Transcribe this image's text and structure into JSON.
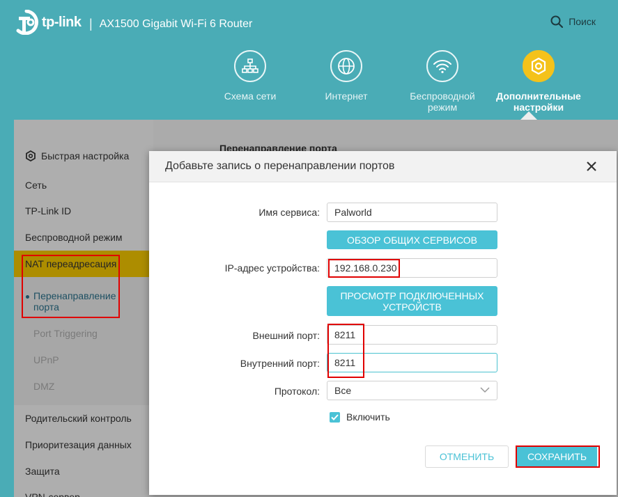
{
  "header": {
    "brand": "tp-link",
    "separator": "|",
    "model": "AX1500 Gigabit Wi-Fi 6 Router",
    "search_label": "Поиск"
  },
  "nav": {
    "items": [
      {
        "label": "Схема сети",
        "icon": "network-map-icon"
      },
      {
        "label": "Интернет",
        "icon": "globe-icon"
      },
      {
        "label": "Беспроводной режим",
        "icon": "wifi-icon"
      },
      {
        "label": "Дополнительные настройки",
        "icon": "gear-icon",
        "active": true
      }
    ]
  },
  "sidebar": {
    "items": [
      {
        "label": "Быстрая настройка",
        "icon": "gear-icon"
      },
      {
        "label": "Сеть"
      },
      {
        "label": "TP-Link ID"
      },
      {
        "label": "Беспроводной режим"
      },
      {
        "label": "NAT переадресация",
        "active": true
      },
      {
        "label": "Родительский контроль"
      },
      {
        "label": "Приоритезация данных"
      },
      {
        "label": "Защита"
      },
      {
        "label": "VPN-сервер"
      }
    ],
    "subitems": [
      {
        "label": "Перенаправление порта",
        "active": true
      },
      {
        "label": "Port Triggering"
      },
      {
        "label": "UPnP"
      },
      {
        "label": "DMZ"
      }
    ]
  },
  "main": {
    "title": "Перенаправление порта"
  },
  "modal": {
    "title": "Добавьте запись о перенаправлении портов",
    "service_name_label": "Имя сервиса:",
    "service_name_value": "Palworld",
    "browse_services_btn": "ОБЗОР ОБЩИХ СЕРВИСОВ",
    "ip_label": "IP-адрес устройства:",
    "ip_value": "192.168.0.230",
    "view_devices_btn": "ПРОСМОТР ПОДКЛЮЧЕННЫХ УСТРОЙСТВ",
    "external_port_label": "Внешний порт:",
    "external_port_value": "8211",
    "internal_port_label": "Внутренний порт:",
    "internal_port_value": "8211",
    "protocol_label": "Протокол:",
    "protocol_value": "Все",
    "enable_label": "Включить",
    "enable_checked": true,
    "cancel_btn": "ОТМЕНИТЬ",
    "save_btn": "СОХРАНИТЬ"
  },
  "colors": {
    "header_bg": "#4aacb6",
    "accent": "#4ac2d6",
    "active_yellow": "#f0c400",
    "highlight_red": "#e00000"
  }
}
